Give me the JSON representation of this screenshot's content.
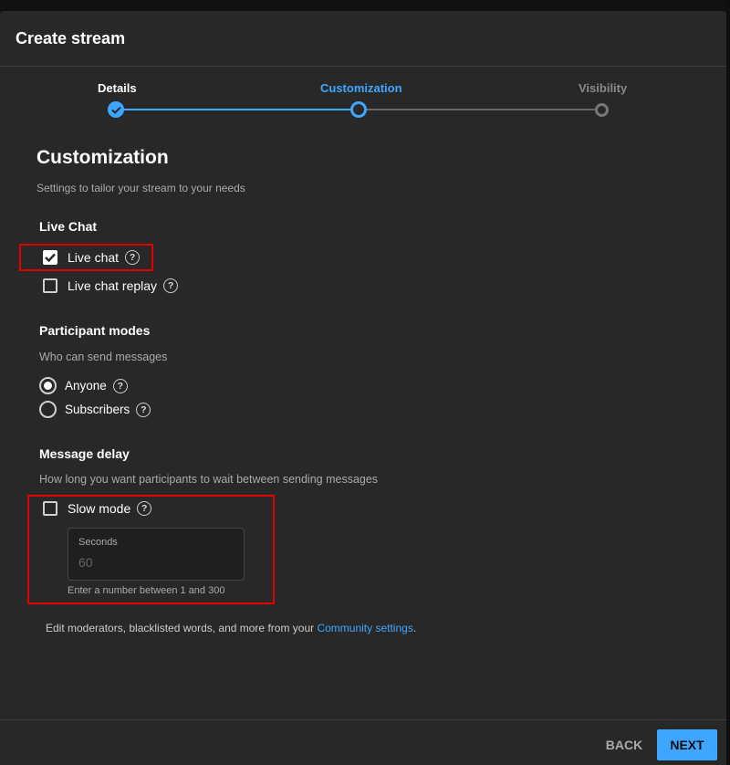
{
  "dialog": {
    "title": "Create stream"
  },
  "steps": [
    {
      "label": "Details",
      "state": "done"
    },
    {
      "label": "Customization",
      "state": "active"
    },
    {
      "label": "Visibility",
      "state": "todo"
    }
  ],
  "section": {
    "title": "Customization",
    "subtitle": "Settings to tailor your stream to your needs"
  },
  "live_chat": {
    "title": "Live Chat",
    "options": [
      {
        "label": "Live chat",
        "checked": true
      },
      {
        "label": "Live chat replay",
        "checked": false
      }
    ]
  },
  "participant_modes": {
    "title": "Participant modes",
    "subtitle": "Who can send messages",
    "options": [
      {
        "label": "Anyone",
        "selected": true
      },
      {
        "label": "Subscribers",
        "selected": false
      }
    ]
  },
  "message_delay": {
    "title": "Message delay",
    "subtitle": "How long you want participants to wait between sending messages",
    "slow_mode": {
      "label": "Slow mode",
      "checked": false
    },
    "seconds_field": {
      "label": "Seconds",
      "placeholder": "60"
    },
    "hint": "Enter a number between 1 and 300"
  },
  "footnote": {
    "text": "Edit moderators, blacklisted words, and more from your ",
    "link": "Community settings",
    "end": "."
  },
  "footer": {
    "back_label": "BACK",
    "next_label": "NEXT"
  },
  "colors": {
    "accent": "#3ea6ff",
    "background": "#282828",
    "highlight_box": "#e00000"
  },
  "icons": {
    "help": "help-circle-icon",
    "check": "checkmark-icon"
  }
}
